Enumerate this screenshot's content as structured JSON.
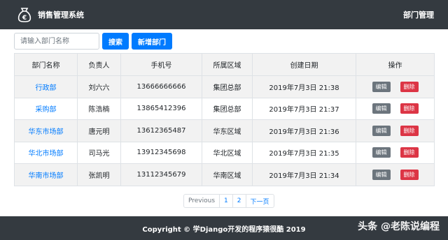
{
  "navbar": {
    "title": "销售管理系统",
    "nav_link": "部门管理"
  },
  "toolbar": {
    "search_placeholder": "请输入部门名称",
    "search_button": "搜索",
    "add_button": "新增部门"
  },
  "table": {
    "headers": [
      "部门名称",
      "负责人",
      "手机号",
      "所属区域",
      "创建日期",
      "操作"
    ],
    "rows": [
      {
        "name": "行政部",
        "manager": "刘六六",
        "phone": "13666666666",
        "region": "集团总部",
        "created": "2019年7月3日 21:38"
      },
      {
        "name": "采购部",
        "manager": "陈浩楠",
        "phone": "13865412396",
        "region": "集团总部",
        "created": "2019年7月3日 21:37"
      },
      {
        "name": "华东市场部",
        "manager": "唐元明",
        "phone": "13612365487",
        "region": "华东区域",
        "created": "2019年7月3日 21:36"
      },
      {
        "name": "华北市场部",
        "manager": "司马光",
        "phone": "13912345698",
        "region": "华北区域",
        "created": "2019年7月3日 21:35"
      },
      {
        "name": "华南市场部",
        "manager": "张凯明",
        "phone": "13112345679",
        "region": "华南区域",
        "created": "2019年7月3日 21:34"
      }
    ],
    "edit_label": "编辑",
    "delete_label": "删除"
  },
  "pagination": {
    "previous": "Previous",
    "pages": [
      "1",
      "2"
    ],
    "next": "下一页"
  },
  "footer": {
    "copyright": "Copyright © 学Django开发的程序猿很酷 2019"
  },
  "watermark": "头条 @老陈说编程",
  "colors": {
    "navbar": "#343a40",
    "primary": "#007bff",
    "edit": "#6c757d",
    "delete": "#dc3545"
  },
  "icons": {
    "brand": "money-bag-icon"
  }
}
